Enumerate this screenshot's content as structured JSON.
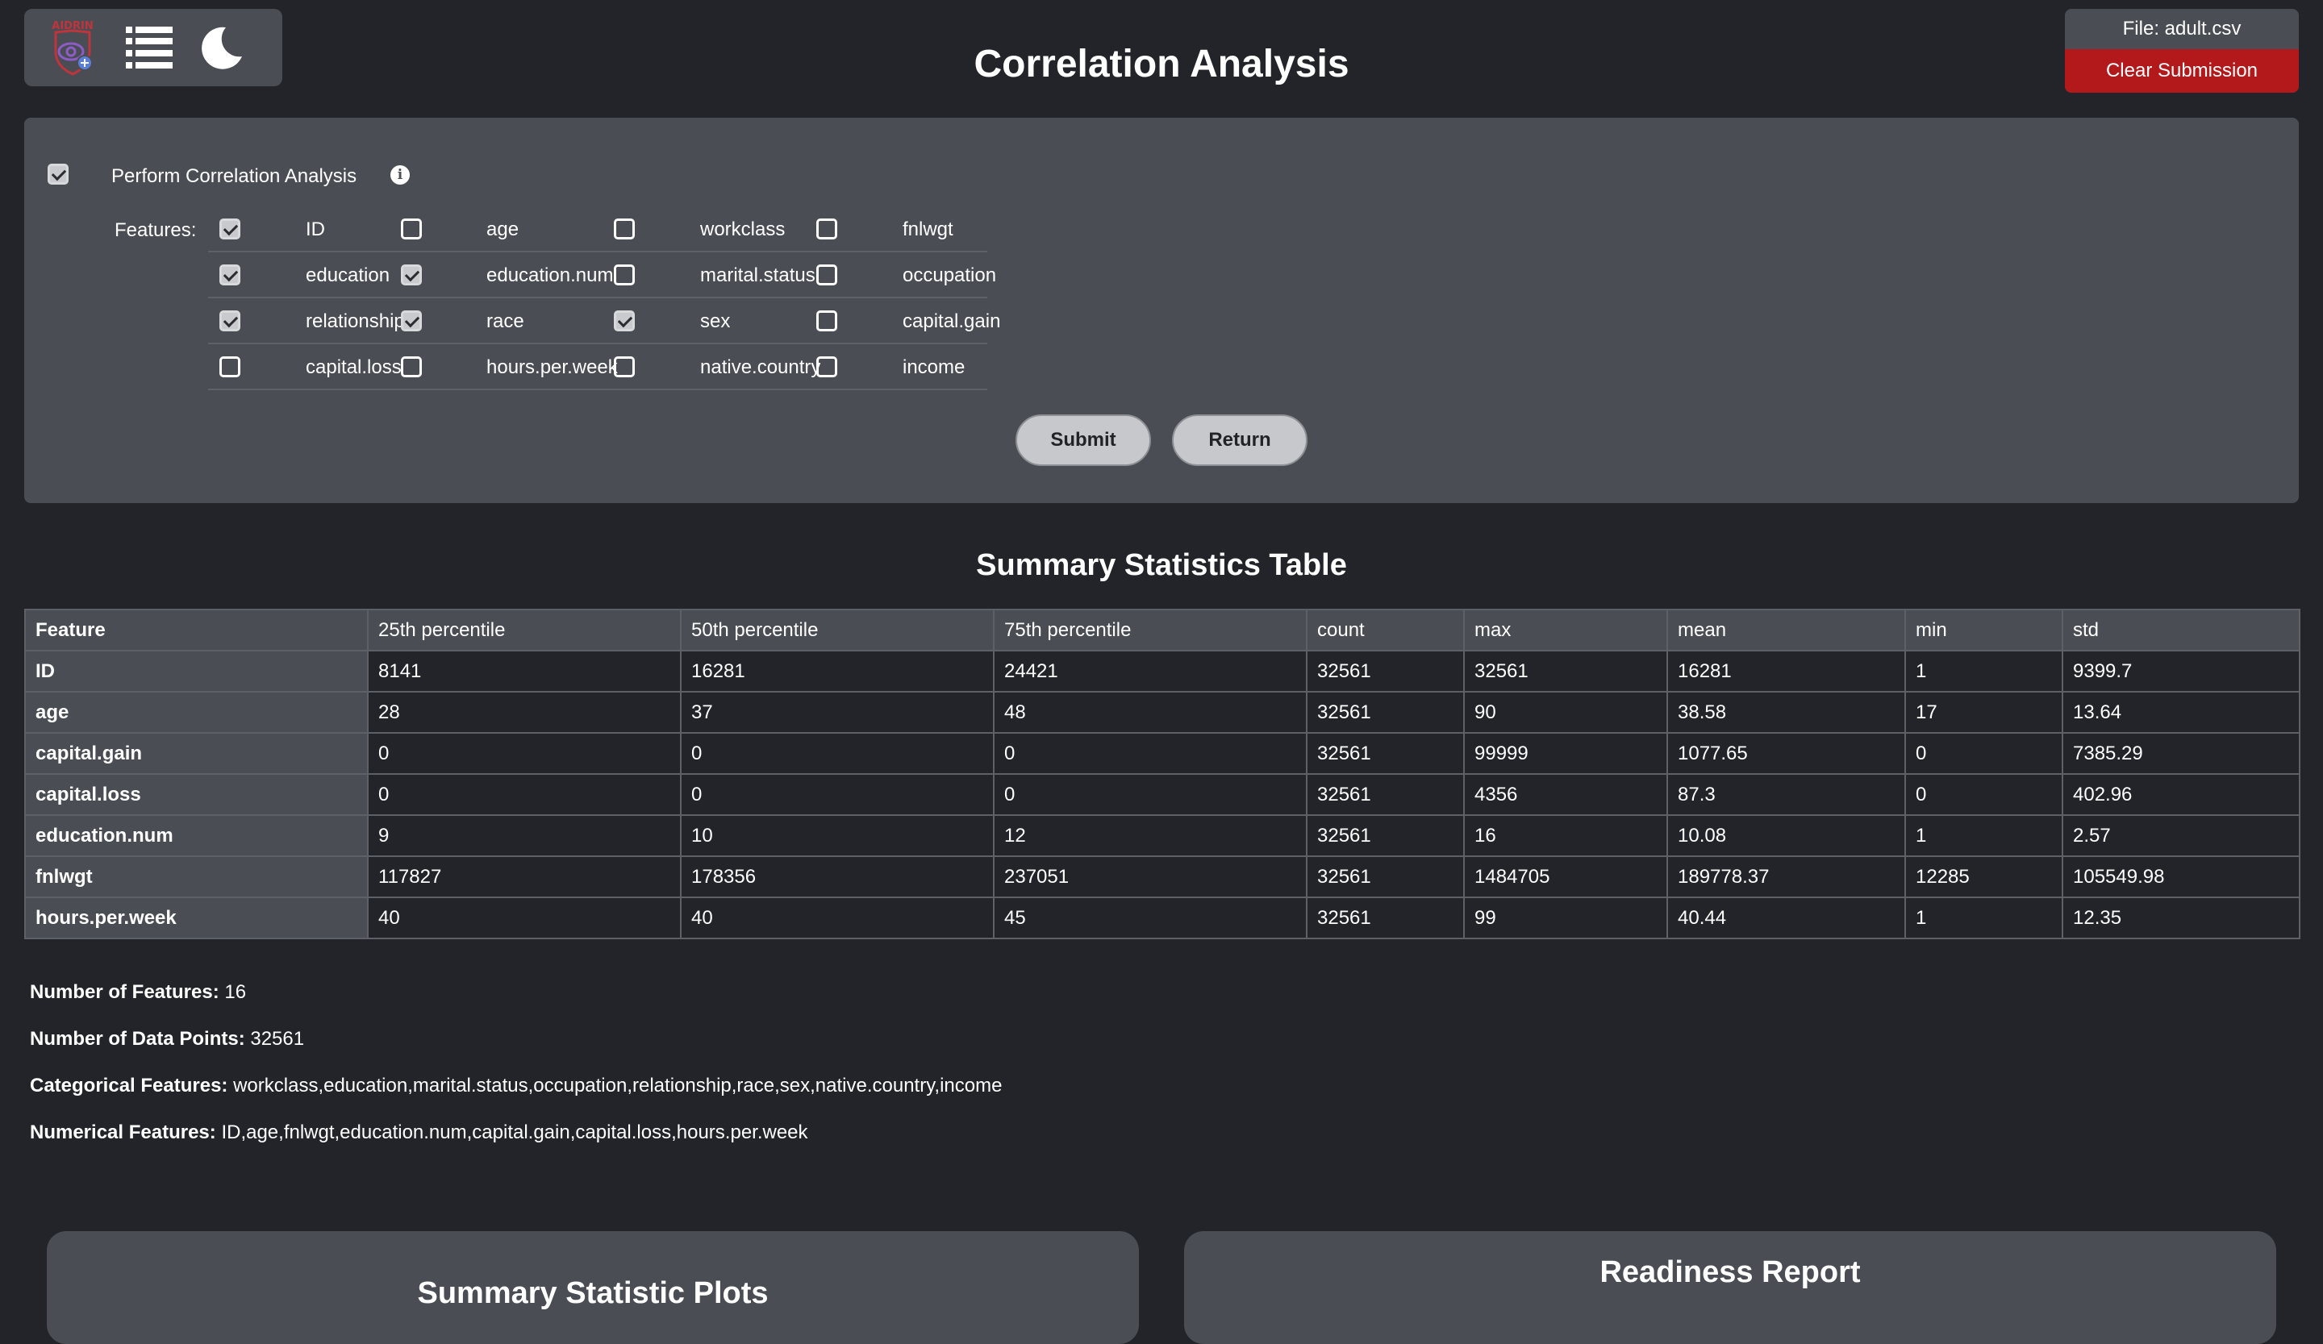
{
  "toolbar": {
    "logo_text": "AIDRIN",
    "icons": [
      "aidrin-logo-icon",
      "list-icon",
      "moon-icon"
    ]
  },
  "page": {
    "title": "Correlation Analysis"
  },
  "file_panel": {
    "file_label": "File: adult.csv",
    "clear_label": "Clear Submission"
  },
  "correlation": {
    "perform_label": "Perform Correlation Analysis",
    "perform_checked": true,
    "features_label": "Features:",
    "features": [
      [
        {
          "label": "ID",
          "checked": true
        },
        {
          "label": "age",
          "checked": false
        },
        {
          "label": "workclass",
          "checked": false
        },
        {
          "label": "fnlwgt",
          "checked": false
        }
      ],
      [
        {
          "label": "education",
          "checked": true
        },
        {
          "label": "education.num",
          "checked": true
        },
        {
          "label": "marital.status",
          "checked": false
        },
        {
          "label": "occupation",
          "checked": false
        }
      ],
      [
        {
          "label": "relationship",
          "checked": true
        },
        {
          "label": "race",
          "checked": true
        },
        {
          "label": "sex",
          "checked": true
        },
        {
          "label": "capital.gain",
          "checked": false
        }
      ],
      [
        {
          "label": "capital.loss",
          "checked": false
        },
        {
          "label": "hours.per.week",
          "checked": false
        },
        {
          "label": "native.country",
          "checked": false
        },
        {
          "label": "income",
          "checked": false
        }
      ]
    ],
    "submit_label": "Submit",
    "return_label": "Return"
  },
  "summary": {
    "title": "Summary Statistics Table",
    "columns": [
      "Feature",
      "25th percentile",
      "50th percentile",
      "75th percentile",
      "count",
      "max",
      "mean",
      "min",
      "std"
    ],
    "rows": [
      [
        "ID",
        "8141",
        "16281",
        "24421",
        "32561",
        "32561",
        "16281",
        "1",
        "9399.7"
      ],
      [
        "age",
        "28",
        "37",
        "48",
        "32561",
        "90",
        "38.58",
        "17",
        "13.64"
      ],
      [
        "capital.gain",
        "0",
        "0",
        "0",
        "32561",
        "99999",
        "1077.65",
        "0",
        "7385.29"
      ],
      [
        "capital.loss",
        "0",
        "0",
        "0",
        "32561",
        "4356",
        "87.3",
        "0",
        "402.96"
      ],
      [
        "education.num",
        "9",
        "10",
        "12",
        "32561",
        "16",
        "10.08",
        "1",
        "2.57"
      ],
      [
        "fnlwgt",
        "117827",
        "178356",
        "237051",
        "32561",
        "1484705",
        "189778.37",
        "12285",
        "105549.98"
      ],
      [
        "hours.per.week",
        "40",
        "40",
        "45",
        "32561",
        "99",
        "40.44",
        "1",
        "12.35"
      ]
    ]
  },
  "info": {
    "num_features_label": "Number of Features:",
    "num_features": "16",
    "num_points_label": "Number of Data Points:",
    "num_points": "32561",
    "categorical_label": "Categorical Features:",
    "categorical": "workclass,education,marital.status,occupation,relationship,race,sex,native.country,income",
    "numerical_label": "Numerical Features:",
    "numerical": "ID,age,fnlwgt,education.num,capital.gain,capital.loss,hours.per.week"
  },
  "cards": {
    "left_title": "Summary Statistic Plots",
    "right_title": "Readiness Report"
  },
  "colors": {
    "background": "#232429",
    "panel": "#4a4d54",
    "danger": "#b3191b",
    "button": "#c7c8cb"
  }
}
